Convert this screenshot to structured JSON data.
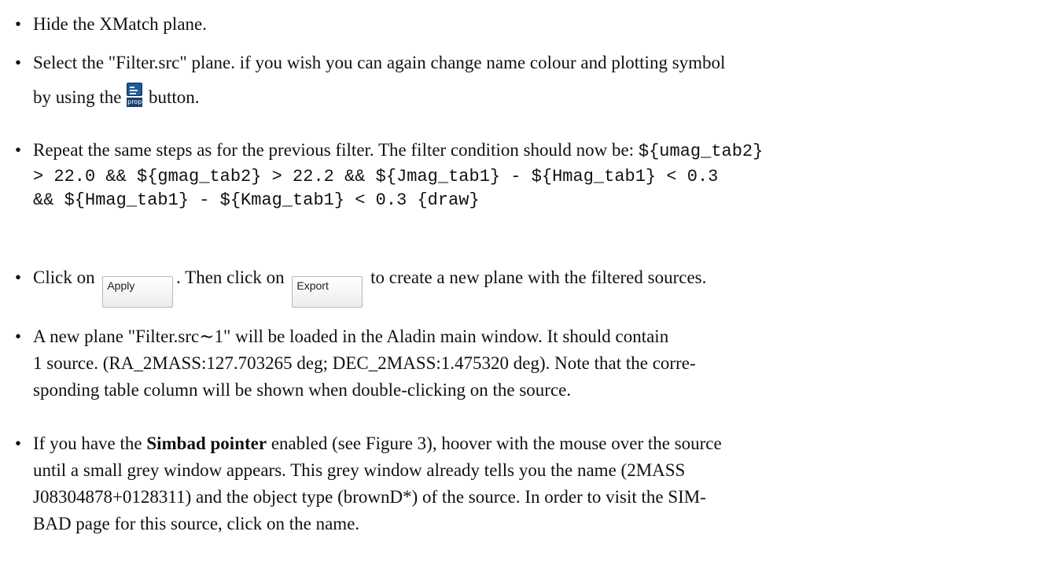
{
  "items": [
    {
      "text": "Hide the XMatch plane."
    },
    {
      "line1": "Select the \"Filter.src\" plane. if you wish you can again change name colour and plotting symbol",
      "before_icon": "by using the",
      "icon_label": "prop",
      "after_icon": "button."
    },
    {
      "intro": "Repeat the same steps as for the previous filter. The filter condition should now be:",
      "code_1": "${umag_tab2}",
      "code_2": "> 22.0 && ${gmag_tab2} > 22.2 && ${Jmag_tab1} - ${Hmag_tab1} < 0.3",
      "code_3": "&& ${Hmag_tab1} - ${Kmag_tab1} < 0.3 {draw}"
    },
    {
      "t1": "Click on",
      "apply_label": "Apply",
      "t2": ". Then click on",
      "export_label": "Export",
      "t3": "to create a new plane with the filtered sources."
    },
    {
      "line1": "A new plane \"Filter.src∼1\" will be loaded in the Aladin main window. It should contain",
      "line2": "1 source. (RA_2MASS:127.703265 deg; DEC_2MASS:1.475320 deg). Note that the corre-",
      "line3": "sponding table column will be shown when double-clicking on the source."
    },
    {
      "l1a": "If you have the",
      "l1bold": "Simbad pointer",
      "l1b": "enabled (see Figure 3), hoover with the mouse over the source",
      "line2": "until a small grey window appears. This grey window already tells you the name (2MASS",
      "line3": "J08304878+0128311) and the object type (brownD*) of the source. In order to visit the SIM-",
      "line4": "BAD page for this source, click on the name."
    }
  ],
  "bullet": "•"
}
